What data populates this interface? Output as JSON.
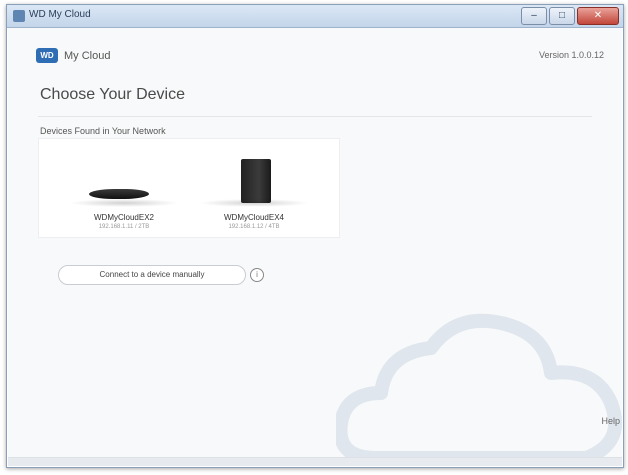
{
  "window": {
    "title": "WD My Cloud",
    "controls": [
      "–",
      "□",
      "✕"
    ]
  },
  "header": {
    "logo": "WD",
    "app_name": "My Cloud",
    "version": "Version 1.0.0.12"
  },
  "main": {
    "title": "Choose Your Device",
    "section_label": "Devices Found in Your Network",
    "devices": [
      {
        "name": "WDMyCloudEX2",
        "sub": "192.168.1.11 / 2TB",
        "icon": "flat-drive-icon"
      },
      {
        "name": "WDMyCloudEX4",
        "sub": "192.168.1.12 / 4TB",
        "icon": "tower-drive-icon"
      }
    ],
    "connect_button": "Connect to a device manually",
    "info_icon": "i"
  },
  "footer": {
    "help_text": "Help"
  },
  "colors": {
    "accent": "#2f6db5",
    "background": "#f8f9fa",
    "cloud_outline": "#dfe6ee"
  }
}
